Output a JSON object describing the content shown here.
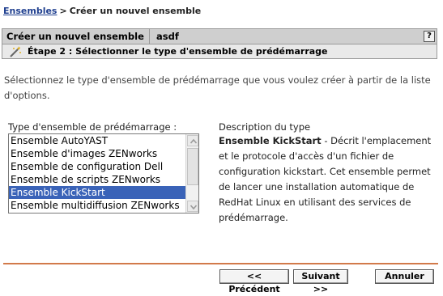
{
  "breadcrumb": {
    "root": "Ensembles",
    "separator": ">",
    "current": "Créer un nouvel ensemble"
  },
  "header": {
    "title": "Créer un nouvel ensemble",
    "name": "asdf",
    "help": "?"
  },
  "step": {
    "label": "Étape 2 : Sélectionner le type d'ensemble de prédémarrage",
    "icon": "wizard-wand-icon"
  },
  "intro": "Sélectionnez le type d'ensemble de prédémarrage que vous voulez créer à partir de la liste d'options.",
  "list": {
    "label": "Type d'ensemble de prédémarrage :",
    "items": [
      "Ensemble AutoYAST",
      "Ensemble d'images ZENworks",
      "Ensemble de configuration Dell",
      "Ensemble de scripts ZENworks",
      "Ensemble KickStart",
      "Ensemble multidiffusion ZENworks"
    ],
    "selected_index": 4
  },
  "description": {
    "title": "Description du type",
    "name": "Ensemble KickStart",
    "text": " - Décrit l'emplacement et le protocole d'accès d'un fichier de configuration kickstart. Cet ensemble permet de lancer une installation automatique de RedHat Linux en utilisant des services de prédémarrage."
  },
  "buttons": {
    "previous": "<< Précédent",
    "next": "Suivant >>",
    "cancel": "Annuler"
  },
  "colors": {
    "selection": "#3a63b8",
    "divider": "#d27a4a",
    "header_bg": "#cfcfcf",
    "link": "#1f3f8f"
  }
}
